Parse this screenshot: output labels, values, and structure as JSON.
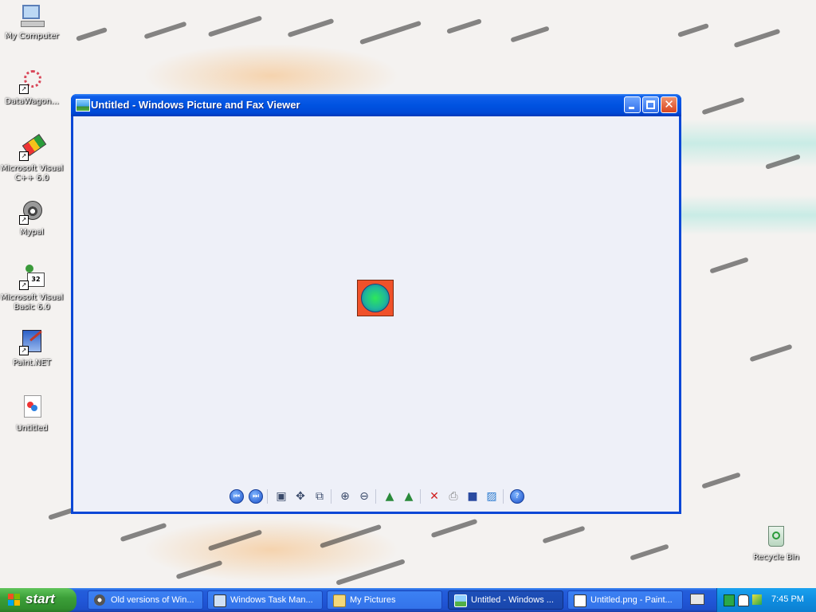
{
  "desktop": {
    "icons": [
      {
        "label": "My Computer",
        "icon": "my-computer-icon"
      },
      {
        "label": "DataWagon...",
        "icon": "datawagon-icon"
      },
      {
        "label": "Microsoft Visual C++ 6.0",
        "icon": "visual-cpp-icon"
      },
      {
        "label": "Mypal",
        "icon": "mypal-icon"
      },
      {
        "label": "Microsoft Visual Basic 6.0",
        "icon": "visual-basic-icon"
      },
      {
        "label": "Paint.NET",
        "icon": "paint-net-icon"
      },
      {
        "label": "Untitled",
        "icon": "image-file-icon"
      },
      {
        "label": "Recycle Bin",
        "icon": "recycle-bin-icon"
      }
    ]
  },
  "window": {
    "title": "Untitled - Windows Picture and Fax Viewer",
    "toolbar": [
      "previous-image-icon",
      "next-image-icon",
      "best-fit-icon",
      "actual-size-icon",
      "slideshow-icon",
      "zoom-in-icon",
      "zoom-out-icon",
      "rotate-clockwise-icon",
      "rotate-counterclockwise-icon",
      "delete-icon",
      "print-icon",
      "save-icon",
      "open-for-editing-icon",
      "help-icon"
    ]
  },
  "taskbar": {
    "start_label": "start",
    "tasks": [
      {
        "label": "Old versions of Win...",
        "icon": "mypal-icon",
        "active": false
      },
      {
        "label": "Windows Task Man...",
        "icon": "task-manager-icon",
        "active": false
      },
      {
        "label": "My Pictures",
        "icon": "folder-icon",
        "active": false
      },
      {
        "label": "Untitled - Windows ...",
        "icon": "picture-viewer-icon",
        "active": true
      },
      {
        "label": "Untitled.png - Paint...",
        "icon": "paint-icon",
        "active": false
      }
    ],
    "clock": "7:45 PM"
  },
  "colors": {
    "window_frame": "#0a47d6",
    "client_bg": "#eef0f8",
    "image_bg": "#f0512a",
    "image_ball": "#1fb89a",
    "taskbar": "#245edb",
    "start_button": "#3c9f39",
    "tray": "#0f8de0"
  }
}
